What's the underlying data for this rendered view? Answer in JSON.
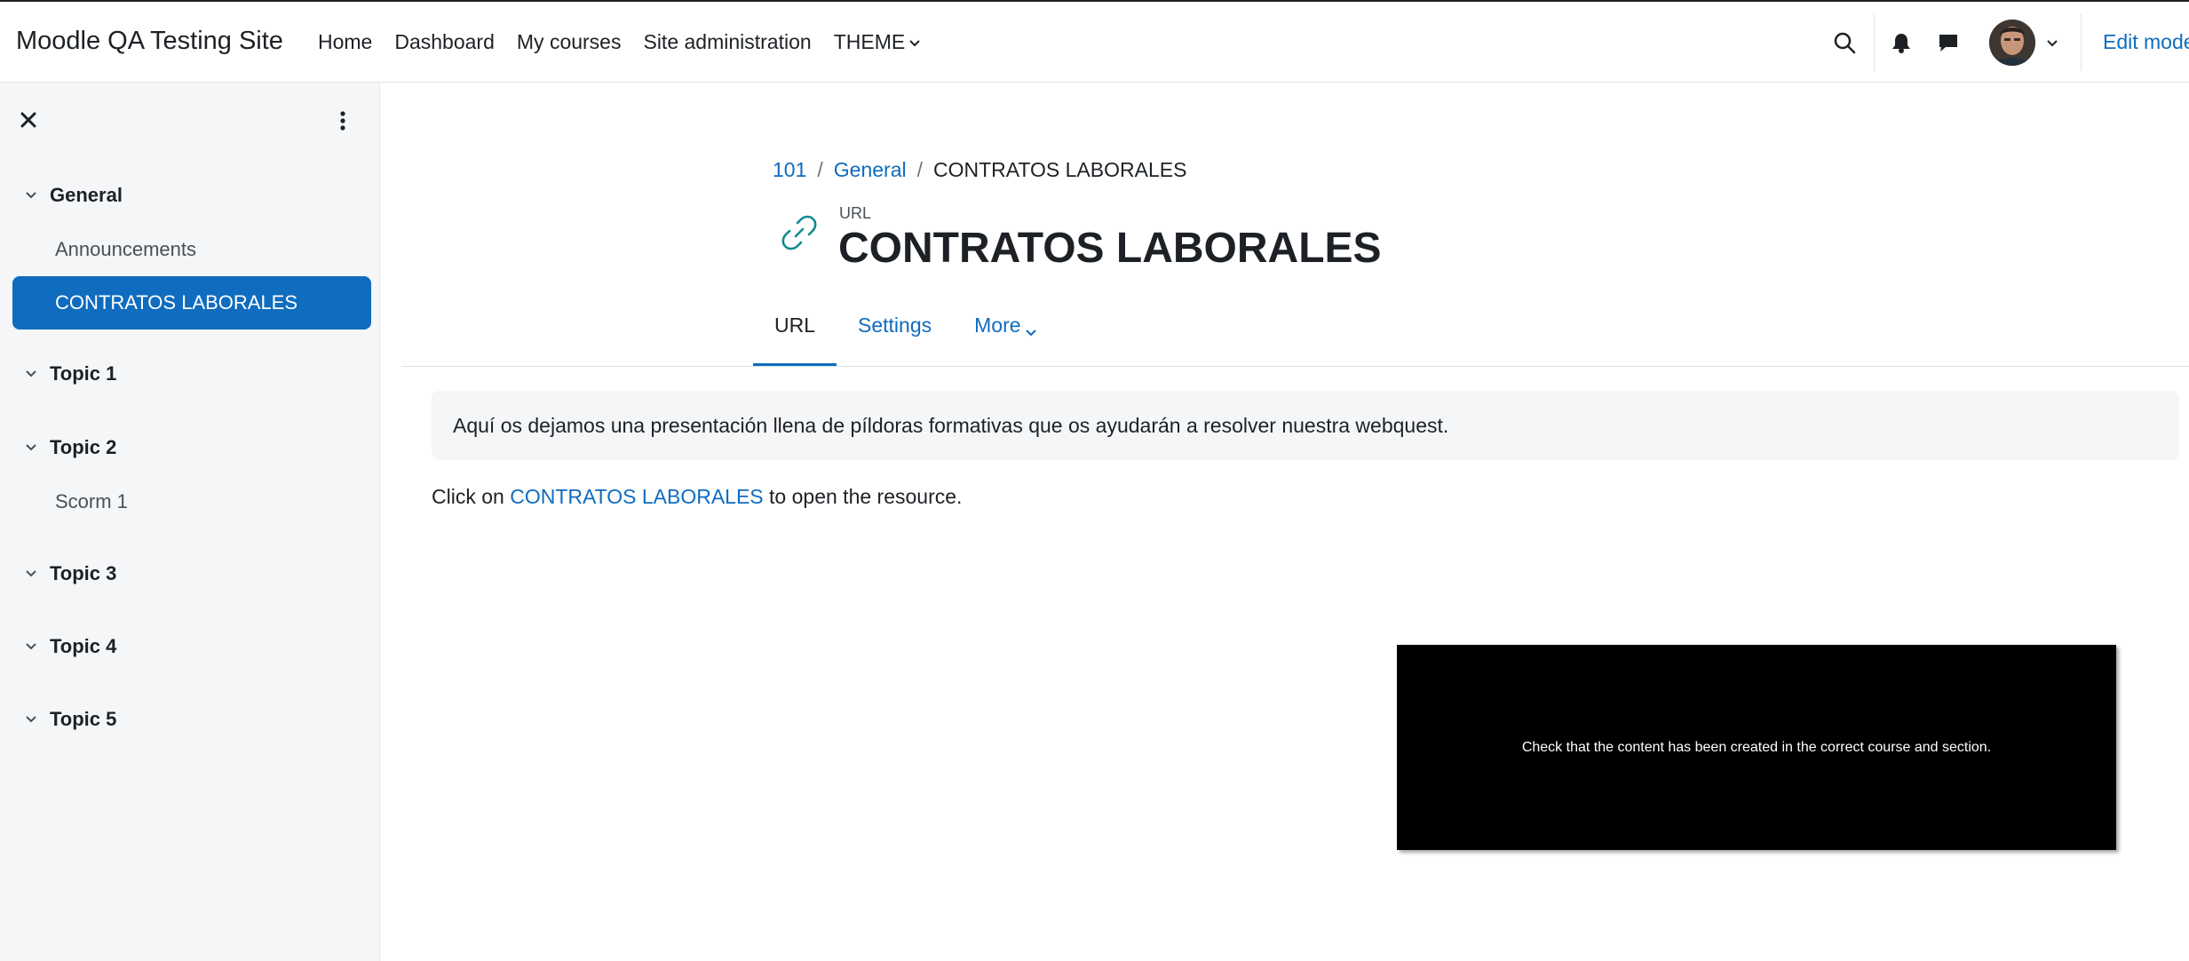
{
  "header": {
    "site_name": "Moodle QA Testing Site",
    "nav": {
      "home": "Home",
      "dashboard": "Dashboard",
      "my_courses": "My courses",
      "site_admin": "Site administration",
      "theme": "THEME"
    },
    "edit_mode_label": "Edit mode"
  },
  "course_index": {
    "sections": [
      {
        "title": "General",
        "items": [
          "Announcements",
          "CONTRATOS LABORALES"
        ]
      },
      {
        "title": "Topic 1",
        "items": []
      },
      {
        "title": "Topic 2",
        "items": [
          "Scorm 1"
        ]
      },
      {
        "title": "Topic 3",
        "items": []
      },
      {
        "title": "Topic 4",
        "items": []
      },
      {
        "title": "Topic 5",
        "items": []
      }
    ]
  },
  "page": {
    "breadcrumb": [
      "101",
      "General",
      "CONTRATOS LABORALES"
    ],
    "activity_type": "URL",
    "title": "CONTRATOS LABORALES",
    "tabs": [
      "URL",
      "Settings",
      "More"
    ],
    "intro": "Aquí os dejamos una presentación llena de píldoras formativas que os ayudarán a resolver nuestra webquest.",
    "click_prefix": "Click on ",
    "click_link": "CONTRATOS LABORALES",
    "click_suffix": " to open the resource."
  },
  "tooltip": {
    "text": "Check that the content has been created in the correct course and section."
  },
  "colors": {
    "primary": "#0f6cbf",
    "text": "#1d2125",
    "drawer_bg": "#f5f6f7",
    "url_icon": "#0f8b8d"
  }
}
